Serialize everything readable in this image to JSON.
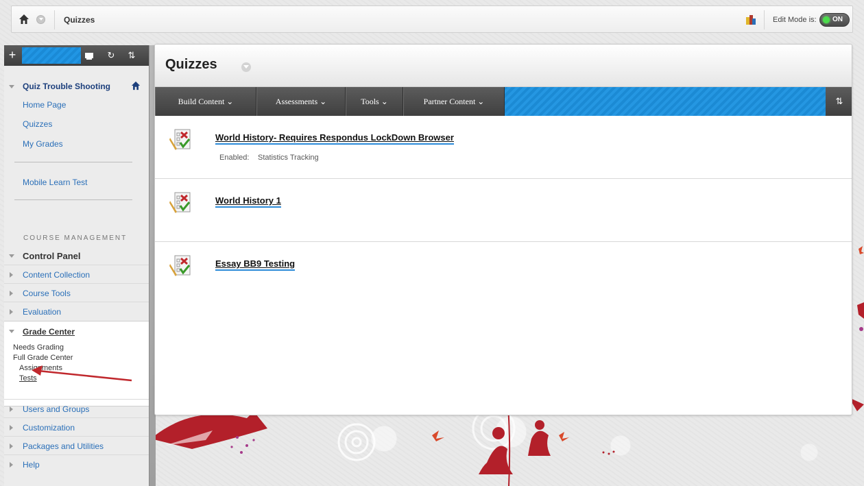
{
  "breadcrumb": {
    "current": "Quizzes"
  },
  "edit_mode": {
    "label": "Edit Mode is:",
    "state": "ON"
  },
  "sidebar": {
    "course_title": "Quiz Trouble Shooting",
    "links": [
      {
        "label": "Home Page"
      },
      {
        "label": "Quizzes"
      },
      {
        "label": "My Grades"
      },
      {
        "label": "Mobile Learn Test"
      }
    ],
    "course_management_label": "COURSE MANAGEMENT",
    "control_panel_label": "Control Panel",
    "panel_items": [
      {
        "label": "Content Collection"
      },
      {
        "label": "Course Tools"
      },
      {
        "label": "Evaluation"
      }
    ],
    "grade_center": {
      "label": "Grade Center",
      "sub": [
        "Needs Grading",
        "Full Grade Center",
        "Assignments",
        "Tests"
      ]
    },
    "panel_items_after": [
      {
        "label": "Users and Groups"
      },
      {
        "label": "Customization"
      },
      {
        "label": "Packages and Utilities"
      },
      {
        "label": "Help"
      }
    ]
  },
  "main": {
    "title": "Quizzes",
    "actions": [
      {
        "label": "Build Content ⌄"
      },
      {
        "label": "Assessments ⌄"
      },
      {
        "label": "Tools ⌄"
      },
      {
        "label": "Partner Content ⌄"
      }
    ],
    "items": [
      {
        "title": "World History- Requires Respondus LockDown Browser",
        "meta_key": "Enabled:",
        "meta_val": "Statistics Tracking"
      },
      {
        "title": "World History 1"
      },
      {
        "title": "Essay BB9 Testing"
      }
    ]
  },
  "colors": {
    "accent_blue": "#2196e4",
    "link_blue": "#2a6fb8",
    "toggle_green": "#4cdc4c",
    "annotation_red": "#c0282d"
  }
}
